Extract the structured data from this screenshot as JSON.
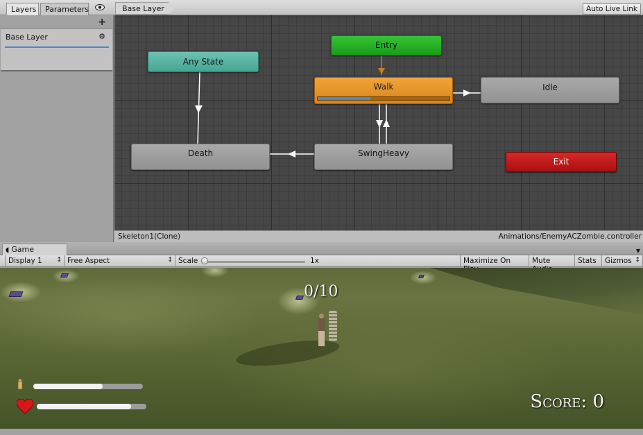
{
  "animator": {
    "tabs": [
      "Layers",
      "Parameters"
    ],
    "breadcrumb": "Base Layer",
    "auto_live_link": "Auto Live Link",
    "add_layer": "+",
    "layers": [
      {
        "name": "Base Layer",
        "weight": 1.0
      }
    ],
    "states": {
      "entry": "Entry",
      "any_state": "Any State",
      "walk": "Walk",
      "idle": "Idle",
      "death": "Death",
      "swing_heavy": "SwingHeavy",
      "exit": "Exit"
    },
    "walk_progress": 0.4,
    "status": {
      "object": "Skeleton1(Clone)",
      "controller": "Animations/EnemyACZombie.controller"
    },
    "colors": {
      "entry": "#2bb32b",
      "any_state": "#5bb4a3",
      "active": "#e69426",
      "exit": "#bf1c1c"
    }
  },
  "game": {
    "tab": "Game",
    "display": "Display 1",
    "aspect": "Free Aspect",
    "scale_label": "Scale",
    "scale_value": "1x",
    "maximize_on_play": "Maximize On Play",
    "mute_audio": "Mute Audio",
    "stats": "Stats",
    "gizmos": "Gizmos",
    "hud": {
      "kills": "0/10",
      "score": "Score: 0",
      "ammo": 0.63,
      "health": 0.86
    },
    "icons": {
      "tab": "game-controller-icon",
      "ammo": "bullet-icon",
      "health": "heart-icon"
    }
  }
}
